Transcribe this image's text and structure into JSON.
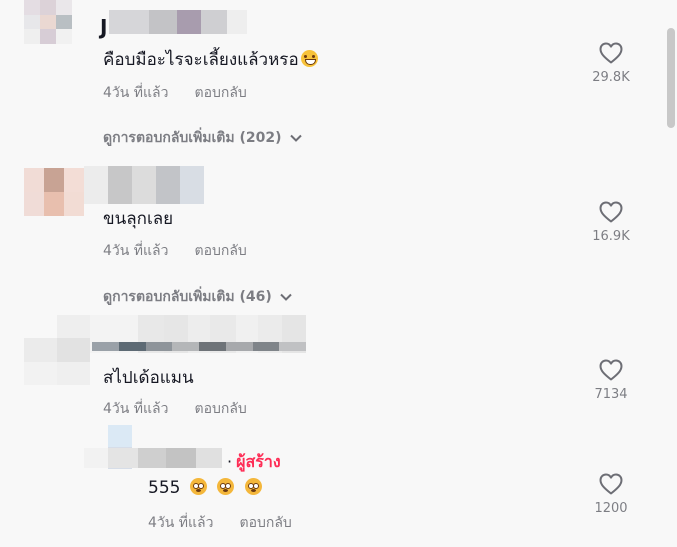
{
  "comments": [
    {
      "username": "J",
      "text": "คือบมือะไรจะเลี้ยงแล้วหรอ",
      "emoji": "grin-emoji",
      "time": "4วัน ที่แล้ว",
      "reply": "ตอบกลับ",
      "likes": "29.8K",
      "more": "ดูการตอบกลับเพิ่มเติม (202)"
    },
    {
      "text": "ขนลุกเลย",
      "time": "4วัน ที่แล้ว",
      "reply": "ตอบกลับ",
      "likes": "16.9K",
      "more": "ดูการตอบกลับเพิ่มเติม (46)"
    },
    {
      "text": "สไปเด้อแมน",
      "time": "4วัน ที่แล้ว",
      "reply": "ตอบกลับ",
      "likes": "7134"
    }
  ],
  "reply": {
    "creator_label": "ผู้สร้าง",
    "separator": "·",
    "text": "555",
    "emojis": [
      "flushed-face-emoji",
      "flushed-face-emoji",
      "flushed-face-emoji"
    ],
    "time": "4วัน ที่แล้ว",
    "reply": "ตอบกลับ",
    "likes": "1200"
  },
  "colors": {
    "accent": "#fe2c55",
    "muted": "#8a8b91",
    "text": "#161823"
  }
}
